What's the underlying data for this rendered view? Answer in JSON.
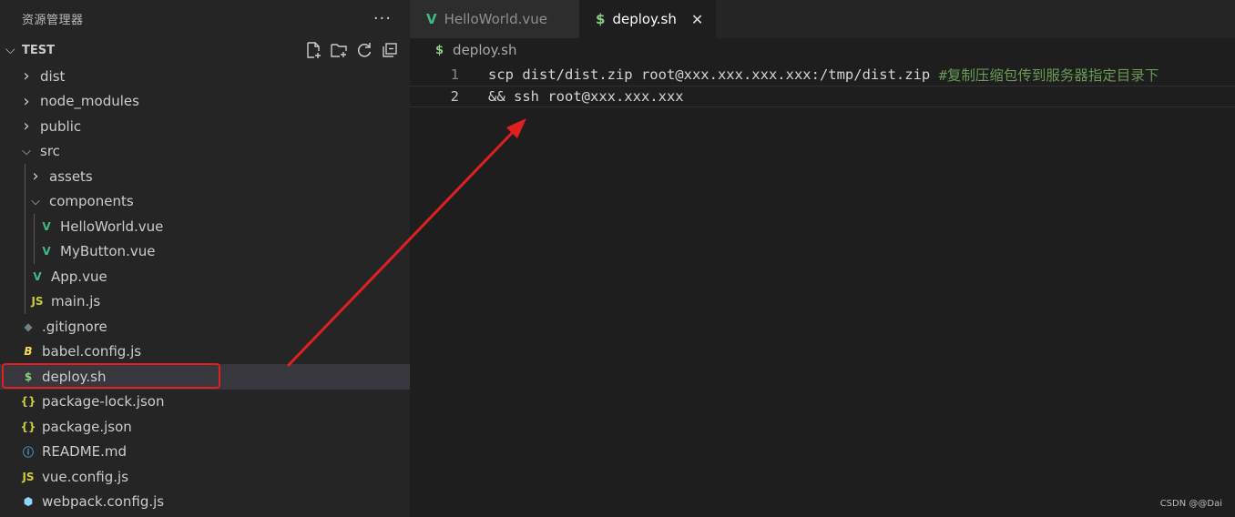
{
  "sidebar": {
    "title": "资源管理器",
    "more": "···",
    "section": {
      "title": "TEST"
    },
    "items": [
      {
        "label": "dist",
        "type": "folder",
        "expanded": false,
        "depth": 0
      },
      {
        "label": "node_modules",
        "type": "folder",
        "expanded": false,
        "depth": 0
      },
      {
        "label": "public",
        "type": "folder",
        "expanded": false,
        "depth": 0
      },
      {
        "label": "src",
        "type": "folder",
        "expanded": true,
        "depth": 0
      },
      {
        "label": "assets",
        "type": "folder",
        "expanded": false,
        "depth": 1
      },
      {
        "label": "components",
        "type": "folder",
        "expanded": true,
        "depth": 1
      },
      {
        "label": "HelloWorld.vue",
        "type": "vue",
        "depth": 2
      },
      {
        "label": "MyButton.vue",
        "type": "vue",
        "depth": 2
      },
      {
        "label": "App.vue",
        "type": "vue",
        "depth": 1
      },
      {
        "label": "main.js",
        "type": "js",
        "depth": 1
      },
      {
        "label": ".gitignore",
        "type": "git",
        "depth": 0
      },
      {
        "label": "babel.config.js",
        "type": "babel",
        "depth": 0
      },
      {
        "label": "deploy.sh",
        "type": "shell",
        "depth": 0,
        "selected": true
      },
      {
        "label": "package-lock.json",
        "type": "json",
        "depth": 0
      },
      {
        "label": "package.json",
        "type": "json",
        "depth": 0
      },
      {
        "label": "README.md",
        "type": "info",
        "depth": 0
      },
      {
        "label": "vue.config.js",
        "type": "js",
        "depth": 0
      },
      {
        "label": "webpack.config.js",
        "type": "webpack",
        "depth": 0
      }
    ]
  },
  "tabs": [
    {
      "label": "HelloWorld.vue",
      "icon": "vue-icon",
      "active": false
    },
    {
      "label": "deploy.sh",
      "icon": "shell-icon",
      "active": true,
      "close": "✕"
    }
  ],
  "breadcrumb": {
    "file": "deploy.sh"
  },
  "editor": {
    "lines": [
      {
        "num": "1",
        "code": "scp dist/dist.zip root@xxx.xxx.xxx.xxx:/tmp/dist.zip ",
        "comment": "#复制压缩包传到服务器指定目录下"
      },
      {
        "num": "2",
        "code": "&& ssh root@xxx.xxx.xxx",
        "comment": ""
      }
    ]
  },
  "watermark": "CSDN @@Dai",
  "colors": {
    "vue": "#41b883",
    "shell": "#89d185",
    "js": "#cbcb41",
    "json": "#cbcb41",
    "babel": "#f5da55",
    "info": "#519aba",
    "webpack": "#8ed6fb",
    "git": "#6d8086",
    "annotation": "#e02020"
  }
}
